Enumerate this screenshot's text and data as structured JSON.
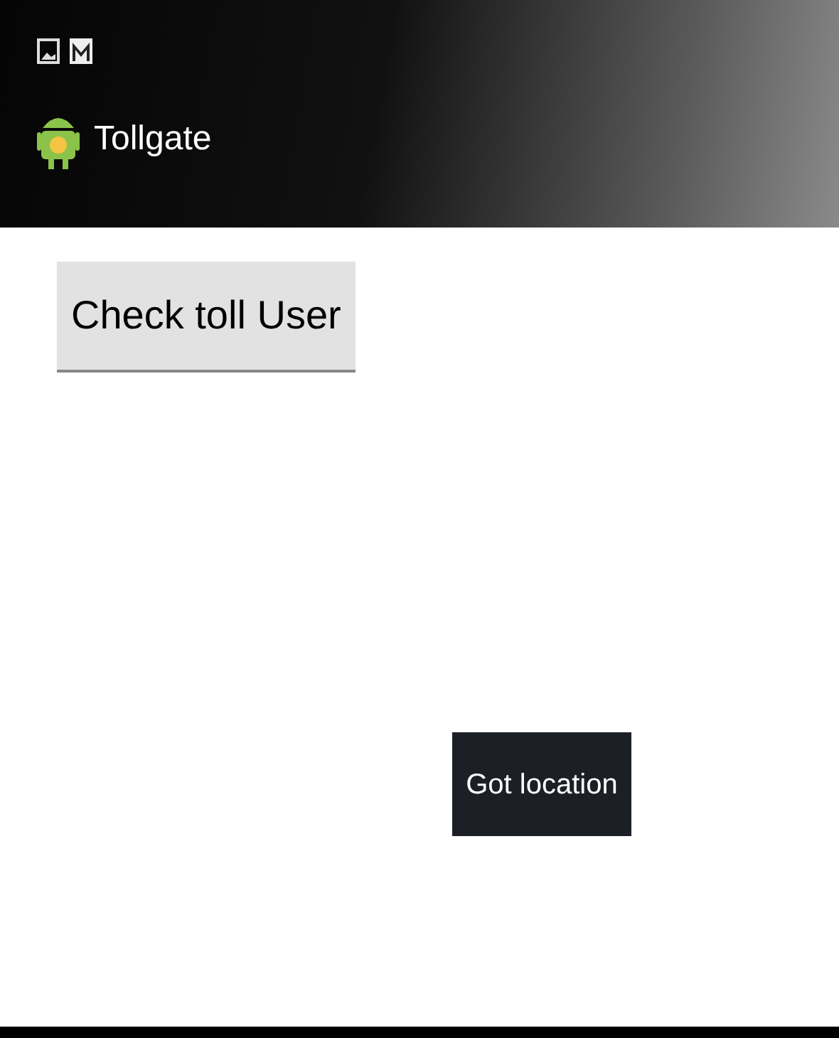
{
  "action_bar": {
    "title": "Tollgate"
  },
  "button": {
    "label": "Check toll User"
  },
  "toast": {
    "text": "Got location"
  }
}
